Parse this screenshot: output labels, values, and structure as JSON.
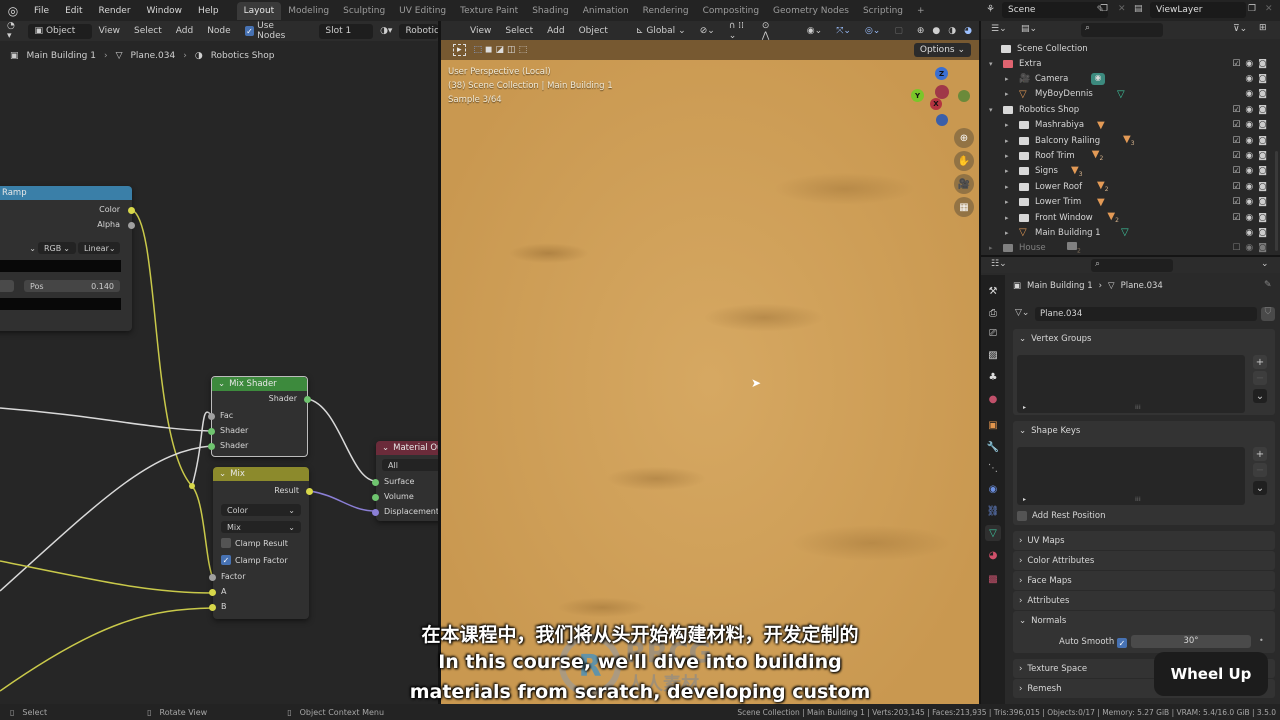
{
  "topbar": {
    "menus": [
      "File",
      "Edit",
      "Render",
      "Window",
      "Help"
    ],
    "workspaces": [
      "Layout",
      "Modeling",
      "Sculpting",
      "UV Editing",
      "Texture Paint",
      "Shading",
      "Animation",
      "Rendering",
      "Compositing",
      "Geometry Nodes",
      "Scripting"
    ],
    "active_workspace": "Layout",
    "add_workspace": "+",
    "scene": "Scene",
    "view_layer": "ViewLayer"
  },
  "node_editor": {
    "header": {
      "mode": "Object",
      "menus": [
        "View",
        "Select",
        "Add",
        "Node"
      ],
      "use_nodes_label": "Use Nodes",
      "use_nodes": true,
      "slot": "Slot 1",
      "material": "Robotics Shop"
    },
    "breadcrumb": [
      "Main Building 1",
      "Plane.034",
      "Robotics Shop"
    ],
    "nodes": {
      "color_ramp": {
        "title": "Ramp",
        "outputs": [
          "Color",
          "Alpha"
        ],
        "color_mode": "RGB",
        "interpolation": "Linear",
        "pos_label": "Pos",
        "pos_value": "0.140"
      },
      "mix_shader": {
        "title": "Mix Shader",
        "output": "Shader",
        "inputs": [
          "Fac",
          "Shader",
          "Shader"
        ]
      },
      "mix": {
        "title": "Mix",
        "output": "Result",
        "data_type": "Color",
        "blend_mode": "Mix",
        "clamp_result_label": "Clamp Result",
        "clamp_result": false,
        "clamp_factor_label": "Clamp Factor",
        "clamp_factor": true,
        "inputs": [
          "Factor",
          "A",
          "B"
        ]
      },
      "material_output": {
        "title": "Material Outp",
        "target": "All",
        "inputs": [
          "Surface",
          "Volume",
          "Displacement"
        ]
      }
    }
  },
  "viewport": {
    "header": {
      "menus": [
        "View",
        "Select",
        "Add",
        "Object"
      ],
      "transform_orientation": "Global",
      "options_label": "Options"
    },
    "overlay_text": [
      "User Perspective (Local)",
      "(38) Scene Collection | Main Building 1",
      "Sample 3/64"
    ],
    "gizmo_axes": [
      "Z",
      "Y",
      "X"
    ]
  },
  "outliner": {
    "root": "Scene Collection",
    "items": [
      {
        "name": "Extra",
        "type": "collection",
        "level": 0,
        "expanded": true,
        "checked": true,
        "color": "#e06470"
      },
      {
        "name": "Camera",
        "type": "camera",
        "level": 1,
        "extra": "camera-data"
      },
      {
        "name": "MyBoyDennis",
        "type": "mesh",
        "level": 1,
        "extra": "mesh-data"
      },
      {
        "name": "Robotics Shop",
        "type": "collection",
        "level": 0,
        "expanded": true,
        "checked": true
      },
      {
        "name": "Mashrabiya",
        "type": "collection",
        "level": 1,
        "count": "",
        "checked": true
      },
      {
        "name": "Balcony Railing",
        "type": "collection",
        "level": 1,
        "count": "3",
        "checked": true
      },
      {
        "name": "Roof Trim",
        "type": "collection",
        "level": 1,
        "count": "2",
        "checked": true
      },
      {
        "name": "Signs",
        "type": "collection",
        "level": 1,
        "count": "3",
        "checked": true
      },
      {
        "name": "Lower Roof",
        "type": "collection",
        "level": 1,
        "count": "2",
        "checked": true
      },
      {
        "name": "Lower Trim",
        "type": "collection",
        "level": 1,
        "count": "",
        "checked": true
      },
      {
        "name": "Front Window",
        "type": "collection",
        "level": 1,
        "count": "2",
        "checked": true
      },
      {
        "name": "Main Building 1",
        "type": "mesh-object",
        "level": 1,
        "extra": "mesh-data"
      },
      {
        "name": "House",
        "type": "collection",
        "level": 0,
        "count": "2",
        "checked": false,
        "dim": true
      }
    ]
  },
  "properties": {
    "breadcrumb": [
      "Main Building 1",
      "Plane.034"
    ],
    "mesh_name": "Plane.034",
    "panels": [
      {
        "label": "Vertex Groups",
        "expanded": true
      },
      {
        "label": "Shape Keys",
        "expanded": true
      },
      {
        "label": "UV Maps",
        "expanded": false
      },
      {
        "label": "Color Attributes",
        "expanded": false
      },
      {
        "label": "Face Maps",
        "expanded": false
      },
      {
        "label": "Attributes",
        "expanded": false
      },
      {
        "label": "Normals",
        "expanded": true
      },
      {
        "label": "Texture Space",
        "expanded": false
      },
      {
        "label": "Remesh",
        "expanded": false
      }
    ],
    "add_rest_position_label": "Add Rest Position",
    "add_rest_position": false,
    "auto_smooth_label": "Auto Smooth",
    "auto_smooth": true,
    "auto_smooth_angle": "30°",
    "tabs": [
      "tool",
      "render",
      "output",
      "view-layer",
      "scene",
      "world",
      "object",
      "modifiers",
      "particles",
      "physics",
      "constraints",
      "data",
      "material",
      "texture"
    ],
    "active_tab": "data"
  },
  "statusbar": {
    "hints": [
      "Select",
      "Rotate View",
      "Object Context Menu"
    ],
    "stats": "Scene Collection | Main Building 1 | Verts:203,145 | Faces:213,935 | Tris:396,015 | Objects:0/17 | Memory: 5.27 GiB | VRAM: 5.4/16.0 GiB | 3.5.0"
  },
  "overlay": {
    "subtitle_cn": "在本课程中，我们将从头开始构建材料，开发定制的",
    "subtitle_en_1": "In this course, we'll dive into building",
    "subtitle_en_2": "materials from scratch, developing custom",
    "key_hint": "Wheel Up",
    "watermark_brand": "RRCG",
    "watermark_sub": "人人素材"
  }
}
